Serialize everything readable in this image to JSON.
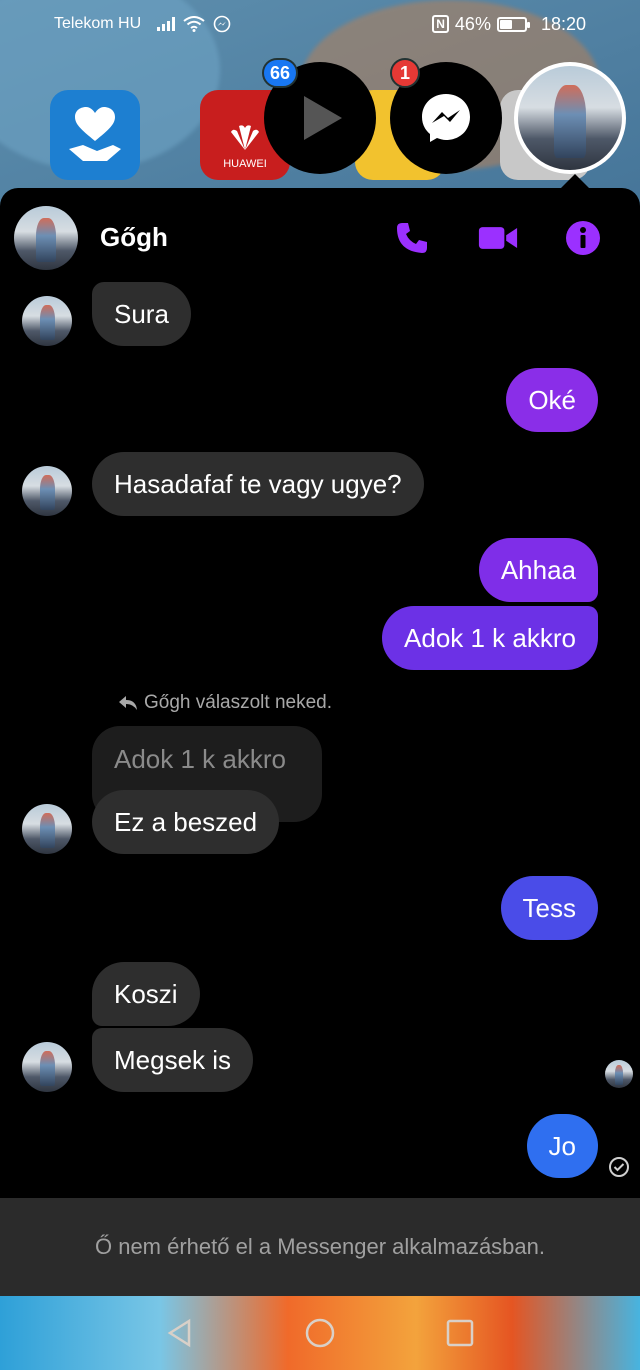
{
  "status_bar": {
    "carrier": "Telekom HU",
    "battery_percent": "46%",
    "battery_level": 0.46,
    "time": "18:20"
  },
  "launcher": {
    "huawei_label": "HUAWEI"
  },
  "chat_heads": [
    {
      "badge": "66",
      "badge_color": "#1877f2"
    },
    {
      "badge": "1",
      "badge_color": "#e53935"
    }
  ],
  "conversation": {
    "contact_name": "Gőgh",
    "accent": "#9b30ff",
    "reply_notice": "Gőgh válaszolt neked.",
    "quoted_text": "Adok 1 k akkro",
    "messages": [
      {
        "from": "them",
        "text": "Sura"
      },
      {
        "from": "me",
        "text": "Oké"
      },
      {
        "from": "them",
        "text": "Hasadafaf te vagy ugye?"
      },
      {
        "from": "me",
        "text": "Ahhaa"
      },
      {
        "from": "me",
        "text": "Adok 1 k akkro"
      },
      {
        "from": "them",
        "text": "Ez a beszed"
      },
      {
        "from": "me",
        "text": "Tess"
      },
      {
        "from": "them",
        "text": "Koszi"
      },
      {
        "from": "them",
        "text": "Megsek is"
      },
      {
        "from": "me",
        "text": "Jo"
      }
    ],
    "unavailable_notice": "Ő nem érhető el a Messenger alkalmazásban."
  }
}
